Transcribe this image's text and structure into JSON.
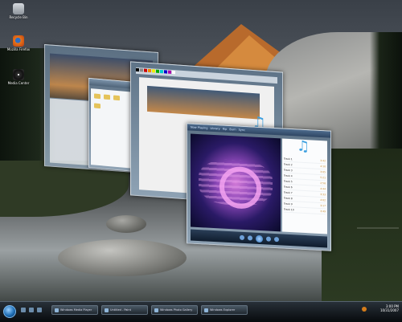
{
  "desktop": {
    "icons": [
      {
        "label": "Recycle Bin",
        "icon": "recycle-bin-icon"
      },
      {
        "label": "Mozilla Firefox",
        "icon": "firefox-icon"
      },
      {
        "label": "Media Center",
        "icon": "disc-icon"
      }
    ]
  },
  "windows": {
    "explorer": {
      "title": ""
    },
    "paint": {
      "title": ""
    },
    "media_player": {
      "now_playing_tabs": [
        "Now Playing",
        "Library",
        "Rip",
        "Burn",
        "Sync"
      ],
      "playlist": [
        {
          "title": "Track 1",
          "duration": "3:42"
        },
        {
          "title": "Track 2",
          "duration": "4:10"
        },
        {
          "title": "Track 3",
          "duration": "3:05"
        },
        {
          "title": "Track 4",
          "duration": "5:21"
        },
        {
          "title": "Track 5",
          "duration": "2:58"
        },
        {
          "title": "Track 6",
          "duration": "4:44"
        },
        {
          "title": "Track 7",
          "duration": "3:33"
        },
        {
          "title": "Track 8",
          "duration": "4:02"
        },
        {
          "title": "Track 9",
          "duration": "3:17"
        },
        {
          "title": "Track 10",
          "duration": "3:49"
        }
      ]
    }
  },
  "taskbar": {
    "buttons": [
      {
        "label": "Windows Media Player"
      },
      {
        "label": "Untitled - Paint"
      },
      {
        "label": "Windows Photo Gallery"
      },
      {
        "label": "Windows Explorer"
      }
    ],
    "clock_time": "3:00 PM",
    "clock_date": "10/31/2007"
  },
  "colors": {
    "accent": "#3da0e0",
    "taskbar": "#0c1014"
  }
}
